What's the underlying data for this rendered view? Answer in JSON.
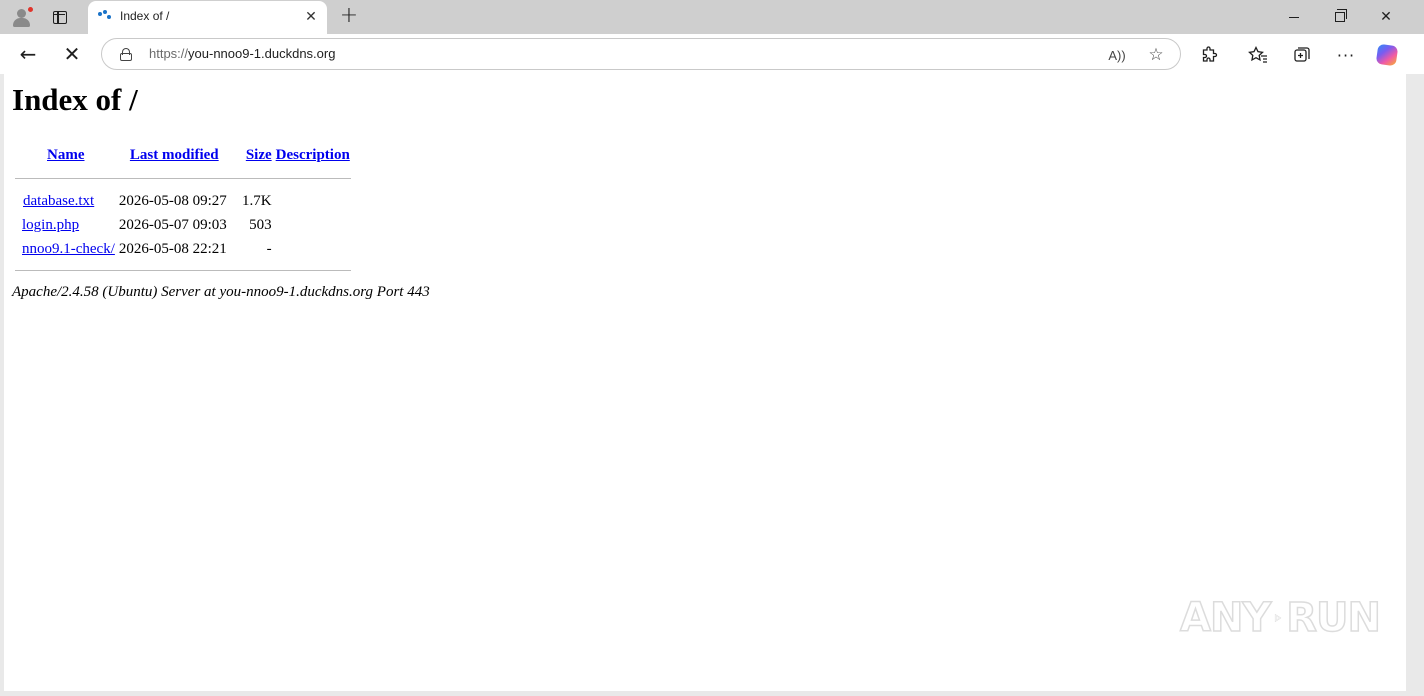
{
  "browser": {
    "tab": {
      "title": "Index of /",
      "close_symbol": "✕"
    },
    "new_tab_symbol": "+",
    "address_bar": {
      "scheme": "https://",
      "host": "you-nnoo9-1.duckdns.org",
      "read_aloud_label": "A))"
    },
    "window_controls": {
      "close_symbol": "✕"
    },
    "toolbar": {
      "back_symbol": "←",
      "stop_symbol": "✕",
      "more_symbol": "···",
      "favorite_symbol": "☆"
    }
  },
  "page": {
    "heading": "Index of /",
    "table": {
      "columns": {
        "name": "Name",
        "last_modified": "Last modified",
        "size": "Size",
        "description": "Description"
      },
      "rows": [
        {
          "name": "database.txt",
          "last_modified": "2026-05-08 09:27",
          "size": "1.7K",
          "description": ""
        },
        {
          "name": "login.php",
          "last_modified": "2026-05-07 09:03",
          "size": "503",
          "description": ""
        },
        {
          "name": "nnoo9.1-check/",
          "last_modified": "2026-05-08 22:21",
          "size": "-",
          "description": ""
        }
      ]
    },
    "footer": "Apache/2.4.58 (Ubuntu) Server at you-nnoo9-1.duckdns.org Port 443"
  },
  "watermark": {
    "left": "ANY",
    "right": "RUN"
  },
  "icons": [
    "profile-icon",
    "tab-actions-icon",
    "site-favicon",
    "lock-icon",
    "read-aloud-icon",
    "favorite-star-icon",
    "extensions-icon",
    "favorites-icon",
    "collections-icon",
    "more-icon",
    "copilot-icon"
  ]
}
